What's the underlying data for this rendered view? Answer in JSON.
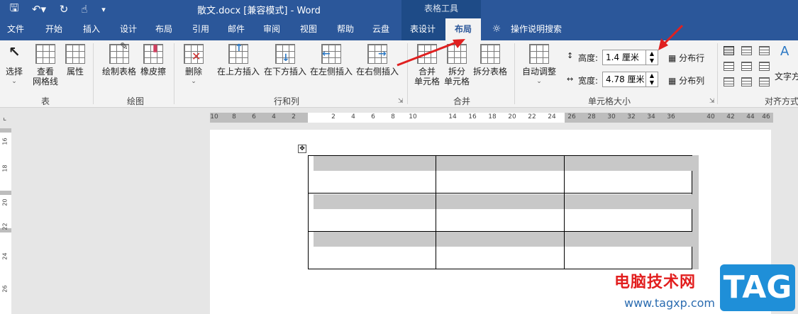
{
  "title_bar": {
    "document_title": "散文.docx [兼容模式]  -  Word",
    "context_group": "表格工具"
  },
  "tabs": [
    "文件",
    "开始",
    "插入",
    "设计",
    "布局",
    "引用",
    "邮件",
    "审阅",
    "视图",
    "帮助",
    "云盘",
    "表设计",
    "布局",
    "操作说明搜索"
  ],
  "ribbon": {
    "table_group": {
      "label": "表",
      "select": "选择",
      "gridlines_1": "查看",
      "gridlines_2": "网格线",
      "properties": "属性"
    },
    "draw_group": {
      "label": "绘图",
      "draw_table": "绘制表格",
      "eraser": "橡皮擦"
    },
    "rows_cols_group": {
      "label": "行和列",
      "delete": "删除",
      "insert_above": "在上方插入",
      "insert_below": "在下方插入",
      "insert_left": "在左侧插入",
      "insert_right": "在右侧插入"
    },
    "merge_group": {
      "label": "合并",
      "merge_1": "合并",
      "merge_2": "单元格",
      "split_1": "拆分",
      "split_2": "单元格",
      "split_table": "拆分表格"
    },
    "cell_size_group": {
      "label": "单元格大小",
      "autofit": "自动调整",
      "height_label": "高度:",
      "height_value": "1.4 厘米",
      "width_label": "宽度:",
      "width_value": "4.78 厘米",
      "distribute_rows": "分布行",
      "distribute_cols": "分布列"
    },
    "align_group": {
      "label": "对齐方式",
      "text_direction": "文字方"
    }
  },
  "ruler": {
    "h_ticks": [
      "10",
      "8",
      "6",
      "4",
      "2",
      "2",
      "4",
      "6",
      "8",
      "10",
      "14",
      "16",
      "18",
      "20",
      "22",
      "24",
      "26",
      "28",
      "30",
      "32",
      "34",
      "36",
      "40",
      "42",
      "44",
      "46"
    ],
    "v_ticks": [
      "16",
      "18",
      "20",
      "22",
      "24",
      "26"
    ]
  },
  "watermark": {
    "site_name": "电脑技术网",
    "url": "www.tagxp.com",
    "badge": "TAG"
  },
  "accent": {
    "title_bar": "#2b579a",
    "arrow": "#e02020"
  }
}
